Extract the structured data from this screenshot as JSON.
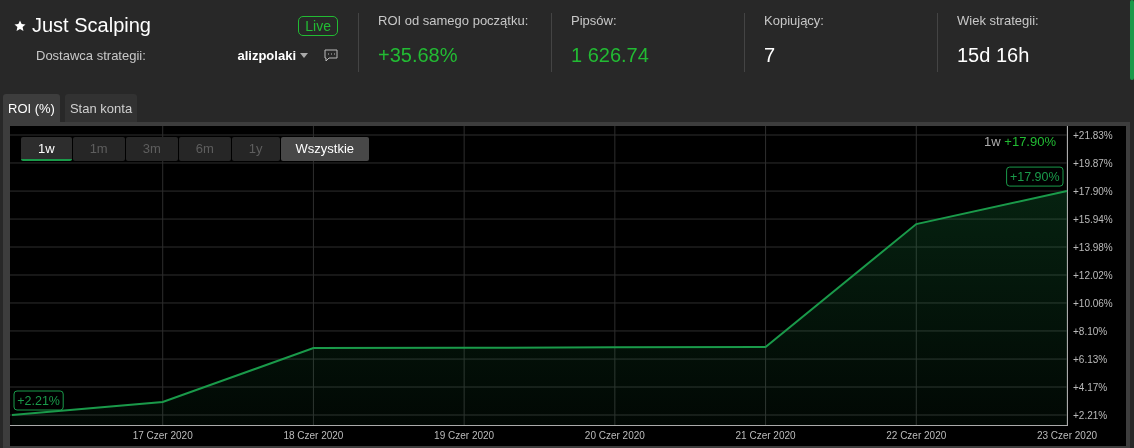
{
  "strategy": {
    "title": "Just Scalping",
    "favorite": true,
    "status": "Live",
    "provider_label": "Dostawca strategii:",
    "provider": "alizpolaki"
  },
  "stats": [
    {
      "label": "ROI od samego początku:",
      "value": "+35.68%",
      "positive": true
    },
    {
      "label": "Pipsów:",
      "value": "1 626.74",
      "positive": true
    },
    {
      "label": "Kopiujący:",
      "value": "7",
      "positive": false
    },
    {
      "label": "Wiek strategii:",
      "value": "15d 16h",
      "positive": false
    }
  ],
  "tabs": [
    {
      "label": "ROI (%)",
      "selected": true
    },
    {
      "label": "Stan konta",
      "selected": false
    }
  ],
  "ranges": [
    {
      "label": "1w",
      "selected": true,
      "disabled": false
    },
    {
      "label": "1m",
      "selected": false,
      "disabled": true
    },
    {
      "label": "3m",
      "selected": false,
      "disabled": true
    },
    {
      "label": "6m",
      "selected": false,
      "disabled": true
    },
    {
      "label": "1y",
      "selected": false,
      "disabled": true
    },
    {
      "label": "Wszystkie",
      "selected": false,
      "disabled": false
    }
  ],
  "summary": {
    "period": "1w",
    "change": "+17.90%"
  },
  "chart_data": {
    "type": "area",
    "categories": [
      null,
      "17 Czer 2020",
      "18 Czer 2020",
      "19 Czer 2020",
      "20 Czer 2020",
      "21 Czer 2020",
      "22 Czer 2020",
      "23 Czer 2020"
    ],
    "series": [
      {
        "color": "#1a9a4a",
        "values": [
          2.21,
          3.12,
          6.9,
          6.92,
          6.95,
          6.97,
          15.59,
          17.9
        ]
      }
    ],
    "yticks": [
      {
        "value": 21.83,
        "label": "+21.83%"
      },
      {
        "value": 19.87,
        "label": "+19.87%"
      },
      {
        "value": 17.9,
        "label": "+17.90%"
      },
      {
        "value": 15.94,
        "label": "+15.94%"
      },
      {
        "value": 13.98,
        "label": "+13.98%"
      },
      {
        "value": 12.02,
        "label": "+12.02%"
      },
      {
        "value": 10.06,
        "label": "+10.06%"
      },
      {
        "value": 8.1,
        "label": "+8.10%"
      },
      {
        "value": 6.13,
        "label": "+6.13%"
      },
      {
        "value": 4.17,
        "label": "+4.17%"
      },
      {
        "value": 2.21,
        "label": "+2.21%"
      }
    ],
    "ylim": [
      2.21,
      21.83
    ],
    "grid": true,
    "annotations": [
      {
        "y": 2.21,
        "text": "+2.21%"
      },
      {
        "x": "23 Czer 2020",
        "y": 17.9,
        "text": "+17.90%"
      }
    ]
  }
}
